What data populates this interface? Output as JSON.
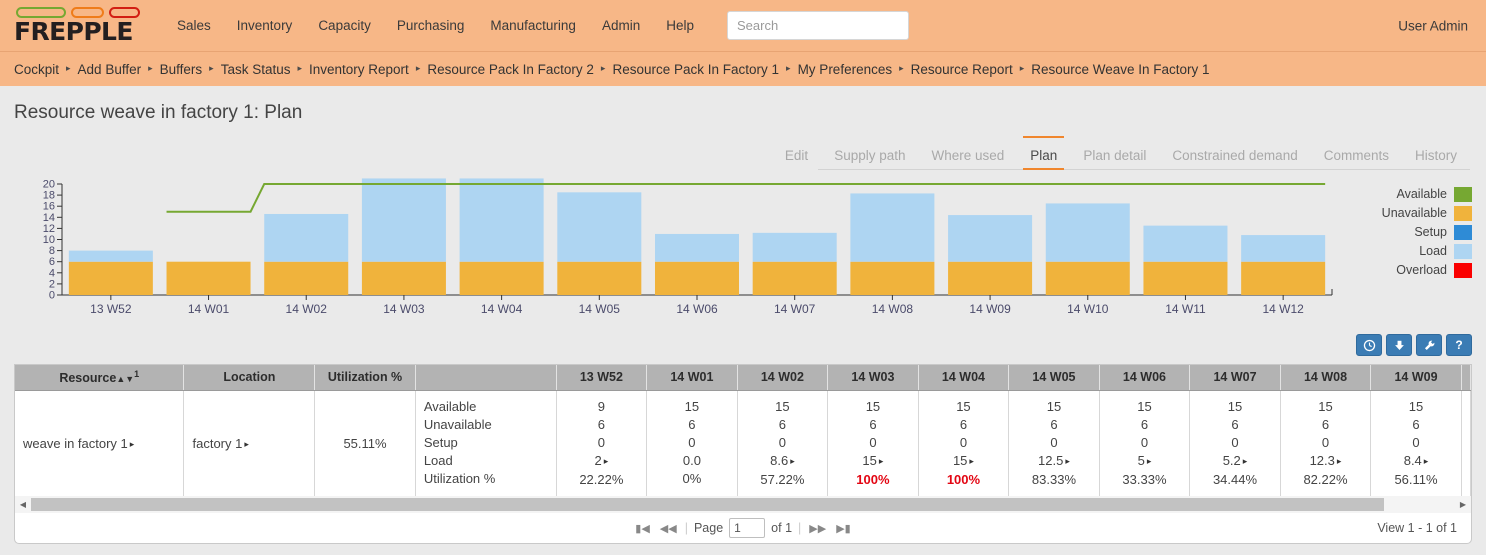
{
  "app": {
    "logo_text": "FREPPLE",
    "user": "User Admin"
  },
  "nav": {
    "items": [
      {
        "label": "Sales"
      },
      {
        "label": "Inventory"
      },
      {
        "label": "Capacity"
      },
      {
        "label": "Purchasing"
      },
      {
        "label": "Manufacturing"
      },
      {
        "label": "Admin"
      },
      {
        "label": "Help"
      }
    ],
    "search_placeholder": "Search",
    "search_value": ""
  },
  "breadcrumb": {
    "items": [
      {
        "label": "Cockpit"
      },
      {
        "label": "Add Buffer"
      },
      {
        "label": "Buffers"
      },
      {
        "label": "Task Status"
      },
      {
        "label": "Inventory Report"
      },
      {
        "label": "Resource Pack In Factory 2"
      },
      {
        "label": "Resource Pack In Factory 1"
      },
      {
        "label": "My Preferences"
      },
      {
        "label": "Resource Report"
      },
      {
        "label": "Resource Weave In Factory 1"
      }
    ],
    "separator": "▸"
  },
  "page": {
    "title": "Resource weave in factory 1: Plan"
  },
  "tabs": [
    {
      "label": "Edit",
      "active": false
    },
    {
      "label": "Supply path",
      "active": false
    },
    {
      "label": "Where used",
      "active": false
    },
    {
      "label": "Plan",
      "active": true
    },
    {
      "label": "Plan detail",
      "active": false
    },
    {
      "label": "Constrained demand",
      "active": false
    },
    {
      "label": "Comments",
      "active": false
    },
    {
      "label": "History",
      "active": false
    }
  ],
  "chart_data": {
    "type": "bar",
    "stacked": true,
    "title": "",
    "xlabel": "",
    "ylabel": "",
    "ylim": [
      0,
      20
    ],
    "yticks": [
      0,
      2,
      4,
      6,
      8,
      10,
      12,
      14,
      16,
      18,
      20
    ],
    "grid": false,
    "legend_position": "right",
    "categories": [
      "13 W52",
      "14 W01",
      "14 W02",
      "14 W03",
      "14 W04",
      "14 W05",
      "14 W06",
      "14 W07",
      "14 W08",
      "14 W09",
      "14 W10",
      "14 W11",
      "14 W12"
    ],
    "series": [
      {
        "name": "Unavailable",
        "color": "#f0b33c",
        "type": "bar",
        "values": [
          6,
          6,
          6,
          6,
          6,
          6,
          6,
          6,
          6,
          6,
          6,
          6,
          6
        ]
      },
      {
        "name": "Setup",
        "color": "#2e8bd6",
        "type": "bar",
        "values": [
          0,
          0,
          0,
          0,
          0,
          0,
          0,
          0,
          0,
          0,
          0,
          0,
          0
        ]
      },
      {
        "name": "Load",
        "color": "#aed5f2",
        "type": "bar",
        "values": [
          2,
          0,
          8.6,
          15,
          15,
          12.5,
          5,
          5.2,
          12.3,
          8.4,
          10.5,
          6.5,
          4.8
        ]
      },
      {
        "name": "Overload",
        "color": "#fa0000",
        "type": "bar",
        "values": [
          0,
          0,
          0,
          0,
          0,
          0,
          0,
          0,
          0,
          0,
          0,
          0,
          0
        ]
      },
      {
        "name": "Available",
        "color": "#76a832",
        "type": "line",
        "values": [
          null,
          15,
          20,
          20,
          20,
          20,
          20,
          20,
          20,
          20,
          20,
          20,
          20
        ]
      }
    ],
    "legend": [
      {
        "label": "Available",
        "color": "#76a832"
      },
      {
        "label": "Unavailable",
        "color": "#f0b33c"
      },
      {
        "label": "Setup",
        "color": "#2e8bd6"
      },
      {
        "label": "Load",
        "color": "#aed5f2"
      },
      {
        "label": "Overload",
        "color": "#fa0000"
      }
    ]
  },
  "toolbar": {
    "buttons": [
      {
        "icon": "clock-icon",
        "glyph": "◷",
        "title": "Time buckets"
      },
      {
        "icon": "download-icon",
        "glyph": "⬇",
        "title": "Export"
      },
      {
        "icon": "wrench-icon",
        "glyph": "ὒ7",
        "title": "Customize"
      },
      {
        "icon": "help-icon",
        "glyph": "?",
        "title": "Help"
      }
    ]
  },
  "table": {
    "fixed_columns": [
      {
        "label": "Resource",
        "sort": "▴▾",
        "sort_index": "1"
      },
      {
        "label": "Location"
      },
      {
        "label": "Utilization %"
      }
    ],
    "bucket_columns": [
      "13 W52",
      "14 W01",
      "14 W02",
      "14 W03",
      "14 W04",
      "14 W05",
      "14 W06",
      "14 W07",
      "14 W08",
      "14 W09"
    ],
    "row_labels": [
      "Available",
      "Unavailable",
      "Setup",
      "Load",
      "Utilization %"
    ],
    "rows": [
      {
        "resource": "weave in factory 1",
        "location": "factory 1",
        "utilization": "55.11%",
        "drill": "▸",
        "buckets": [
          {
            "bucket": "13 W52",
            "available": "9",
            "unavailable": "6",
            "setup": "0",
            "load": "2",
            "load_drill": true,
            "utilization": "22.22%",
            "over": false
          },
          {
            "bucket": "14 W01",
            "available": "15",
            "unavailable": "6",
            "setup": "0",
            "load": "0.0",
            "load_drill": false,
            "utilization": "0%",
            "over": false
          },
          {
            "bucket": "14 W02",
            "available": "15",
            "unavailable": "6",
            "setup": "0",
            "load": "8.6",
            "load_drill": true,
            "utilization": "57.22%",
            "over": false
          },
          {
            "bucket": "14 W03",
            "available": "15",
            "unavailable": "6",
            "setup": "0",
            "load": "15",
            "load_drill": true,
            "utilization": "100%",
            "over": true
          },
          {
            "bucket": "14 W04",
            "available": "15",
            "unavailable": "6",
            "setup": "0",
            "load": "15",
            "load_drill": true,
            "utilization": "100%",
            "over": true
          },
          {
            "bucket": "14 W05",
            "available": "15",
            "unavailable": "6",
            "setup": "0",
            "load": "12.5",
            "load_drill": true,
            "utilization": "83.33%",
            "over": false
          },
          {
            "bucket": "14 W06",
            "available": "15",
            "unavailable": "6",
            "setup": "0",
            "load": "5",
            "load_drill": true,
            "utilization": "33.33%",
            "over": false
          },
          {
            "bucket": "14 W07",
            "available": "15",
            "unavailable": "6",
            "setup": "0",
            "load": "5.2",
            "load_drill": true,
            "utilization": "34.44%",
            "over": false
          },
          {
            "bucket": "14 W08",
            "available": "15",
            "unavailable": "6",
            "setup": "0",
            "load": "12.3",
            "load_drill": true,
            "utilization": "82.22%",
            "over": false
          },
          {
            "bucket": "14 W09",
            "available": "15",
            "unavailable": "6",
            "setup": "0",
            "load": "8.4",
            "load_drill": true,
            "utilization": "56.11%",
            "over": false
          }
        ]
      }
    ]
  },
  "pager": {
    "first_glyph": "⏮",
    "prev_glyph": "⏪",
    "page_label": "Page",
    "page_value": "1",
    "of_label": "of 1",
    "next_glyph": "⏩",
    "last_glyph": "⏭",
    "view_label": "View 1 - 1 of 1"
  }
}
